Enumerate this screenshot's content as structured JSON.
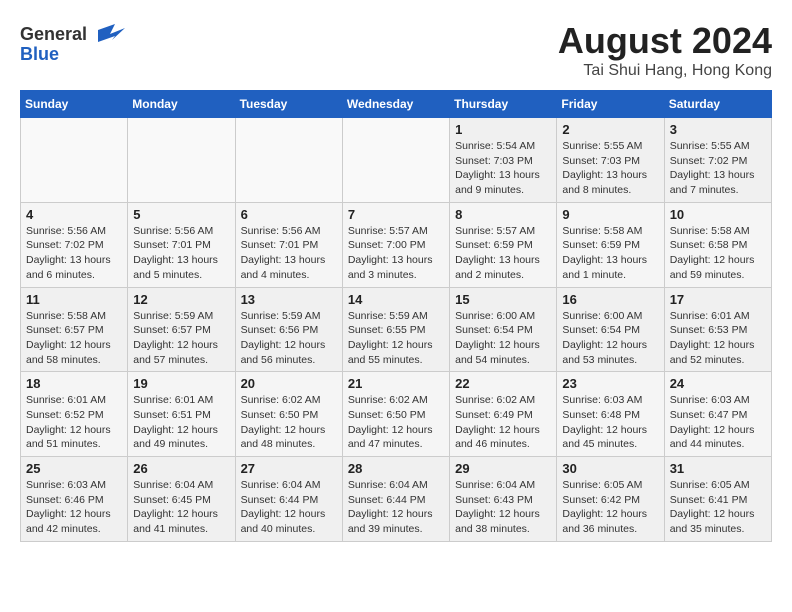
{
  "header": {
    "logo_general": "General",
    "logo_blue": "Blue",
    "month_year": "August 2024",
    "location": "Tai Shui Hang, Hong Kong"
  },
  "weekdays": [
    "Sunday",
    "Monday",
    "Tuesday",
    "Wednesday",
    "Thursday",
    "Friday",
    "Saturday"
  ],
  "weeks": [
    [
      {
        "day": "",
        "info": ""
      },
      {
        "day": "",
        "info": ""
      },
      {
        "day": "",
        "info": ""
      },
      {
        "day": "",
        "info": ""
      },
      {
        "day": "1",
        "info": "Sunrise: 5:54 AM\nSunset: 7:03 PM\nDaylight: 13 hours\nand 9 minutes."
      },
      {
        "day": "2",
        "info": "Sunrise: 5:55 AM\nSunset: 7:03 PM\nDaylight: 13 hours\nand 8 minutes."
      },
      {
        "day": "3",
        "info": "Sunrise: 5:55 AM\nSunset: 7:02 PM\nDaylight: 13 hours\nand 7 minutes."
      }
    ],
    [
      {
        "day": "4",
        "info": "Sunrise: 5:56 AM\nSunset: 7:02 PM\nDaylight: 13 hours\nand 6 minutes."
      },
      {
        "day": "5",
        "info": "Sunrise: 5:56 AM\nSunset: 7:01 PM\nDaylight: 13 hours\nand 5 minutes."
      },
      {
        "day": "6",
        "info": "Sunrise: 5:56 AM\nSunset: 7:01 PM\nDaylight: 13 hours\nand 4 minutes."
      },
      {
        "day": "7",
        "info": "Sunrise: 5:57 AM\nSunset: 7:00 PM\nDaylight: 13 hours\nand 3 minutes."
      },
      {
        "day": "8",
        "info": "Sunrise: 5:57 AM\nSunset: 6:59 PM\nDaylight: 13 hours\nand 2 minutes."
      },
      {
        "day": "9",
        "info": "Sunrise: 5:58 AM\nSunset: 6:59 PM\nDaylight: 13 hours\nand 1 minute."
      },
      {
        "day": "10",
        "info": "Sunrise: 5:58 AM\nSunset: 6:58 PM\nDaylight: 12 hours\nand 59 minutes."
      }
    ],
    [
      {
        "day": "11",
        "info": "Sunrise: 5:58 AM\nSunset: 6:57 PM\nDaylight: 12 hours\nand 58 minutes."
      },
      {
        "day": "12",
        "info": "Sunrise: 5:59 AM\nSunset: 6:57 PM\nDaylight: 12 hours\nand 57 minutes."
      },
      {
        "day": "13",
        "info": "Sunrise: 5:59 AM\nSunset: 6:56 PM\nDaylight: 12 hours\nand 56 minutes."
      },
      {
        "day": "14",
        "info": "Sunrise: 5:59 AM\nSunset: 6:55 PM\nDaylight: 12 hours\nand 55 minutes."
      },
      {
        "day": "15",
        "info": "Sunrise: 6:00 AM\nSunset: 6:54 PM\nDaylight: 12 hours\nand 54 minutes."
      },
      {
        "day": "16",
        "info": "Sunrise: 6:00 AM\nSunset: 6:54 PM\nDaylight: 12 hours\nand 53 minutes."
      },
      {
        "day": "17",
        "info": "Sunrise: 6:01 AM\nSunset: 6:53 PM\nDaylight: 12 hours\nand 52 minutes."
      }
    ],
    [
      {
        "day": "18",
        "info": "Sunrise: 6:01 AM\nSunset: 6:52 PM\nDaylight: 12 hours\nand 51 minutes."
      },
      {
        "day": "19",
        "info": "Sunrise: 6:01 AM\nSunset: 6:51 PM\nDaylight: 12 hours\nand 49 minutes."
      },
      {
        "day": "20",
        "info": "Sunrise: 6:02 AM\nSunset: 6:50 PM\nDaylight: 12 hours\nand 48 minutes."
      },
      {
        "day": "21",
        "info": "Sunrise: 6:02 AM\nSunset: 6:50 PM\nDaylight: 12 hours\nand 47 minutes."
      },
      {
        "day": "22",
        "info": "Sunrise: 6:02 AM\nSunset: 6:49 PM\nDaylight: 12 hours\nand 46 minutes."
      },
      {
        "day": "23",
        "info": "Sunrise: 6:03 AM\nSunset: 6:48 PM\nDaylight: 12 hours\nand 45 minutes."
      },
      {
        "day": "24",
        "info": "Sunrise: 6:03 AM\nSunset: 6:47 PM\nDaylight: 12 hours\nand 44 minutes."
      }
    ],
    [
      {
        "day": "25",
        "info": "Sunrise: 6:03 AM\nSunset: 6:46 PM\nDaylight: 12 hours\nand 42 minutes."
      },
      {
        "day": "26",
        "info": "Sunrise: 6:04 AM\nSunset: 6:45 PM\nDaylight: 12 hours\nand 41 minutes."
      },
      {
        "day": "27",
        "info": "Sunrise: 6:04 AM\nSunset: 6:44 PM\nDaylight: 12 hours\nand 40 minutes."
      },
      {
        "day": "28",
        "info": "Sunrise: 6:04 AM\nSunset: 6:44 PM\nDaylight: 12 hours\nand 39 minutes."
      },
      {
        "day": "29",
        "info": "Sunrise: 6:04 AM\nSunset: 6:43 PM\nDaylight: 12 hours\nand 38 minutes."
      },
      {
        "day": "30",
        "info": "Sunrise: 6:05 AM\nSunset: 6:42 PM\nDaylight: 12 hours\nand 36 minutes."
      },
      {
        "day": "31",
        "info": "Sunrise: 6:05 AM\nSunset: 6:41 PM\nDaylight: 12 hours\nand 35 minutes."
      }
    ]
  ]
}
